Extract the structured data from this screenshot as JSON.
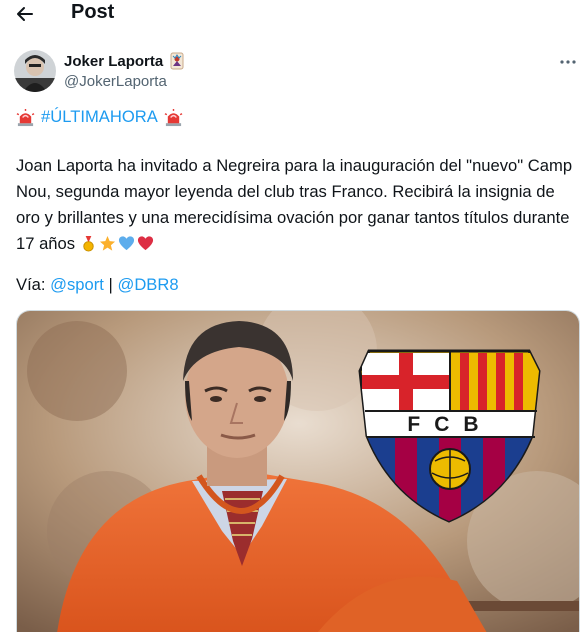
{
  "header": {
    "title": "Post"
  },
  "author": {
    "display_name": "Joker Laporta",
    "handle": "@JokerLaporta"
  },
  "tweet": {
    "hashtag": "#ÚLTIMAHORA",
    "body": "Joan Laporta ha invitado a Negreira para la inauguración del \"nuevo\" Camp Nou, segunda mayor leyenda del club tras Franco. Recibirá la insignia de oro y brillantes y una merecidísima ovación por ganar tantos títulos durante 17 años",
    "via_label": "Vía:",
    "mention_1": "@sport",
    "separator": "|",
    "mention_2": "@DBR8"
  },
  "crest": {
    "letters": "FCB"
  },
  "icons": {
    "back": "arrow-left-icon",
    "more": "more-horizontal-icon",
    "siren": "police-light-icon",
    "medal": "medal-icon",
    "star": "star-icon",
    "blue_heart": "blue-heart-icon",
    "red_heart": "red-heart-icon"
  },
  "colors": {
    "link": "#1d9bf0",
    "text": "#0f1419",
    "muted": "#536471",
    "crest_blue": "#1b3e8f",
    "crest_red": "#a50044",
    "crest_gold": "#edbb00",
    "sweater": "#e8662a"
  }
}
